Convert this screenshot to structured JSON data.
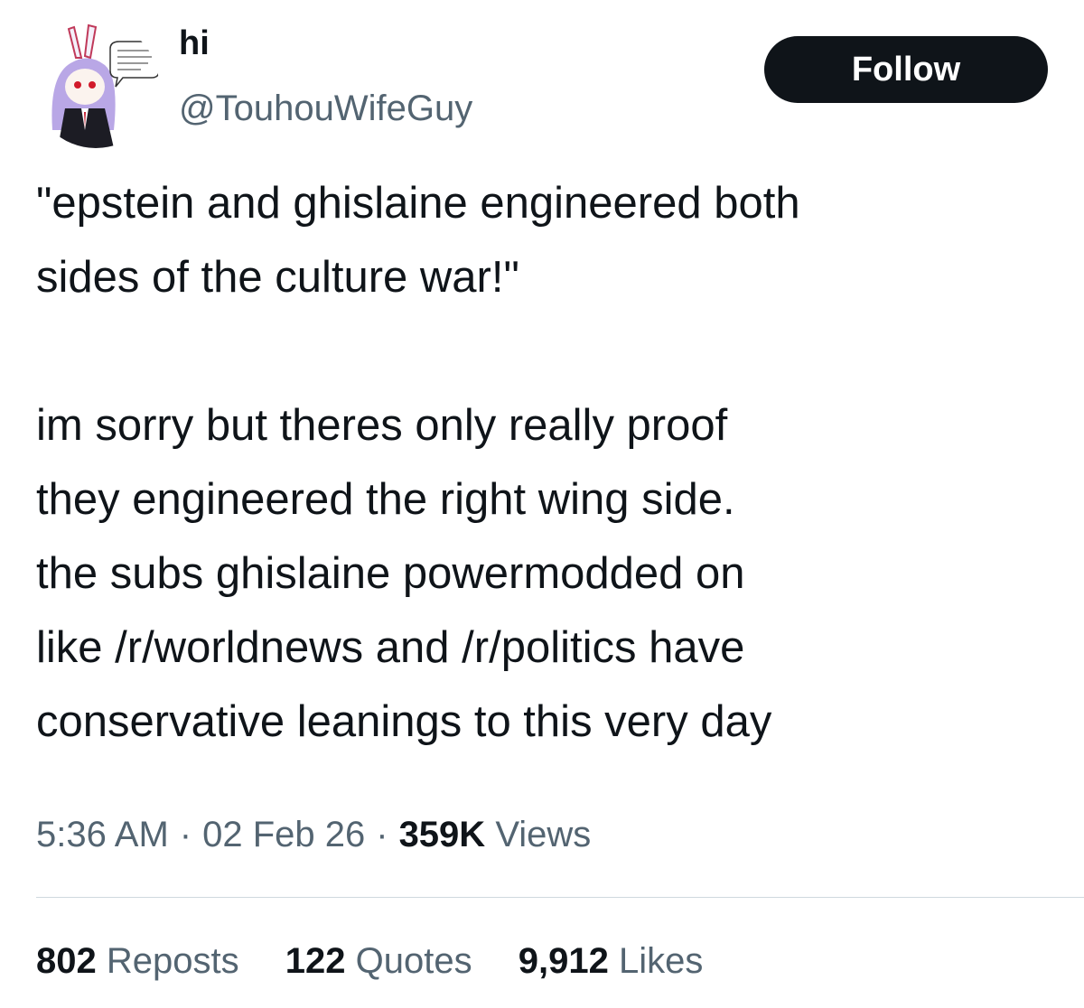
{
  "author": {
    "display_name": "hi",
    "handle": "@TouhouWifeGuy",
    "avatar_icon": "anime-girl-avatar-icon"
  },
  "follow_button": {
    "label": "Follow",
    "background": "#0f1419",
    "text_color": "#ffffff"
  },
  "tweet": {
    "paragraph_1": [
      "\"epstein and ghislaine engineered both",
      "sides of the culture war!\""
    ],
    "paragraph_2": [
      "im sorry but theres only really proof",
      "they engineered the right wing side.",
      "the subs ghislaine powermodded on",
      "like /r/worldnews and /r/politics have",
      "conservative leanings to this very day"
    ]
  },
  "meta": {
    "time": "5:36 AM",
    "date": "02 Feb 26",
    "views_count": "359K",
    "views_label": "Views",
    "separator": "·"
  },
  "stats": {
    "reposts": {
      "count": "802",
      "label": "Reposts"
    },
    "quotes": {
      "count": "122",
      "label": "Quotes"
    },
    "likes": {
      "count": "9,912",
      "label": "Likes"
    }
  },
  "colors": {
    "primary_text": "#0f1419",
    "secondary_text": "#536471",
    "divider": "#cfd9de"
  }
}
